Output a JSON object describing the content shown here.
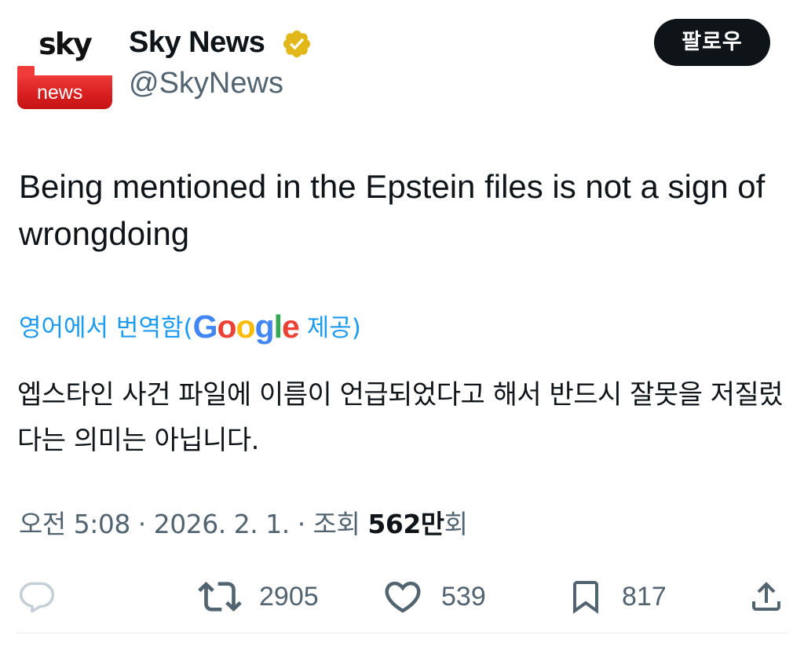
{
  "author": {
    "display_name": "Sky News",
    "handle": "@SkyNews",
    "avatar_logo": {
      "top_word": "sky",
      "bottom_word": "news",
      "colors": {
        "bar": "#d91f1f",
        "top_text": "#111111",
        "bottom_text": "#ffffff"
      }
    },
    "verified_badge_icon": "verified-badge-gold-icon",
    "verified_color": "#e2b719"
  },
  "follow_button": {
    "label": "팔로우"
  },
  "tweet": {
    "text": "Being mentioned in the Epstein files is not a sign of wrongdoing"
  },
  "translation": {
    "prefix": "영어에서 번역함(",
    "provider_letters": [
      "G",
      "o",
      "o",
      "g",
      "l",
      "e"
    ],
    "suffix": " 제공)",
    "text": "엡스타인 사건 파일에 이름이 언급되었다고 해서 반드시 잘못을 저질렀다는 의미는 아닙니다.",
    "link_color": "#1d9bf0"
  },
  "meta": {
    "timestamp": "오전 5:08 · 2026. 2. 1. · 조회 ",
    "views_count": "562만",
    "views_suffix": "회"
  },
  "actions": {
    "reply": {
      "icon": "reply-bubble-icon",
      "count": ""
    },
    "retweet": {
      "icon": "retweet-icon",
      "count": "2905"
    },
    "like": {
      "icon": "heart-icon",
      "count": "539"
    },
    "bookmark": {
      "icon": "bookmark-icon",
      "count": "817"
    },
    "share": {
      "icon": "share-upload-icon",
      "count": ""
    }
  },
  "colors": {
    "text_primary": "#0f1419",
    "text_secondary": "#536471",
    "follow_button_bg": "#0f1419"
  }
}
